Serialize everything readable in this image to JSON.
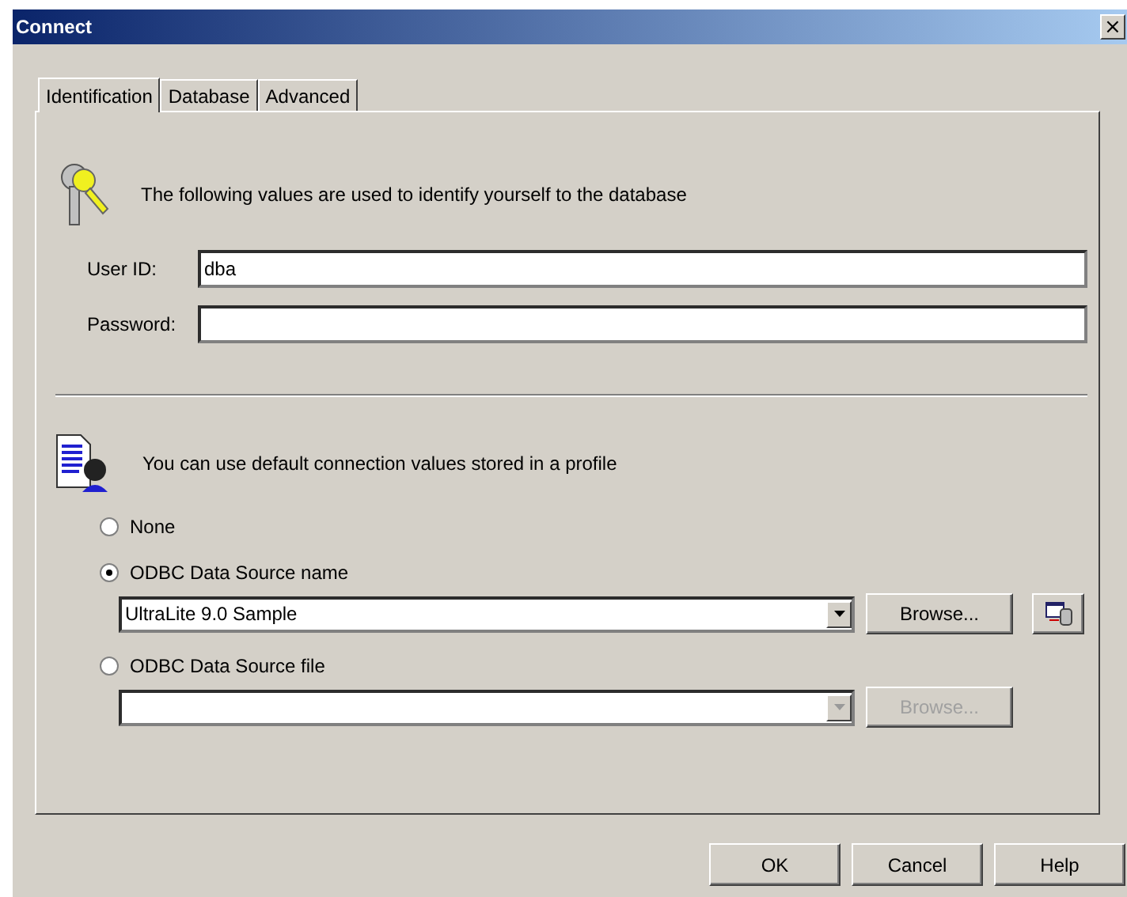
{
  "window": {
    "title": "Connect",
    "close": "×"
  },
  "tabs": [
    {
      "label": "Identification",
      "selected": true
    },
    {
      "label": "Database",
      "selected": false
    },
    {
      "label": "Advanced",
      "selected": false
    }
  ],
  "identification": {
    "message": "The following values are used to identify yourself to the database",
    "fields": [
      {
        "label": "User ID:",
        "value": "dba"
      },
      {
        "label": "Password:"
      }
    ]
  },
  "profile": {
    "message": "You can use default connection values stored in a profile",
    "options": [
      {
        "label": "None",
        "selected": false
      },
      {
        "label": "ODBC Data Source name",
        "selected": true,
        "combo": {
          "value": "UltraLite 9.0 Sample",
          "browse": "Browse...",
          "disabled": false,
          "extra_button": true
        }
      },
      {
        "label": "ODBC Data Source file",
        "selected": false,
        "combo": {
          "browse": "Browse...",
          "disabled": true
        }
      }
    ]
  },
  "buttons": [
    "OK",
    "Cancel",
    "Help"
  ]
}
